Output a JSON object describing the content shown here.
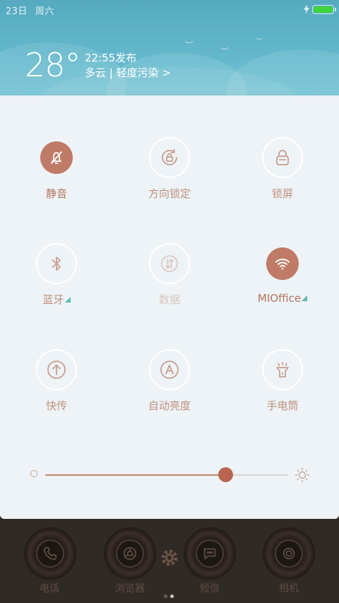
{
  "status": {
    "date": "23日",
    "weekday": "周六"
  },
  "weather": {
    "temperature": "28°",
    "publish_time": "22:55发布",
    "condition": "多云 | 轻度污染 >"
  },
  "toggles": [
    {
      "id": "mute",
      "label": "静音",
      "state": "on",
      "icon": "bell-off-icon"
    },
    {
      "id": "rotation-lock",
      "label": "方向锁定",
      "state": "off",
      "icon": "rotation-lock-icon"
    },
    {
      "id": "lock-screen",
      "label": "锁屏",
      "state": "off",
      "icon": "padlock-icon"
    },
    {
      "id": "bluetooth",
      "label": "蓝牙",
      "state": "off",
      "icon": "bluetooth-icon"
    },
    {
      "id": "data",
      "label": "数据",
      "state": "disabled",
      "icon": "data-arrows-icon"
    },
    {
      "id": "wifi",
      "label": "MIOffice",
      "state": "on",
      "icon": "wifi-icon"
    },
    {
      "id": "quick-share",
      "label": "快传",
      "state": "off",
      "icon": "upload-arrow-icon"
    },
    {
      "id": "auto-brightness",
      "label": "自动亮度",
      "state": "off",
      "icon": "auto-a-icon"
    },
    {
      "id": "flashlight",
      "label": "手电筒",
      "state": "off",
      "icon": "flashlight-icon"
    }
  ],
  "brightness": {
    "value": 0.74
  },
  "dock": [
    {
      "label": "电话",
      "icon": "phone-icon"
    },
    {
      "label": "浏览器",
      "icon": "browser-icon"
    },
    {
      "label": "短信",
      "icon": "message-icon"
    },
    {
      "label": "相机",
      "icon": "camera-icon"
    }
  ],
  "colors": {
    "accent": "#bf7b67",
    "header": "#62b7cb",
    "panel": "#edf3f6",
    "battery": "#3fd43a",
    "corner_marker": "#5bbab3"
  }
}
